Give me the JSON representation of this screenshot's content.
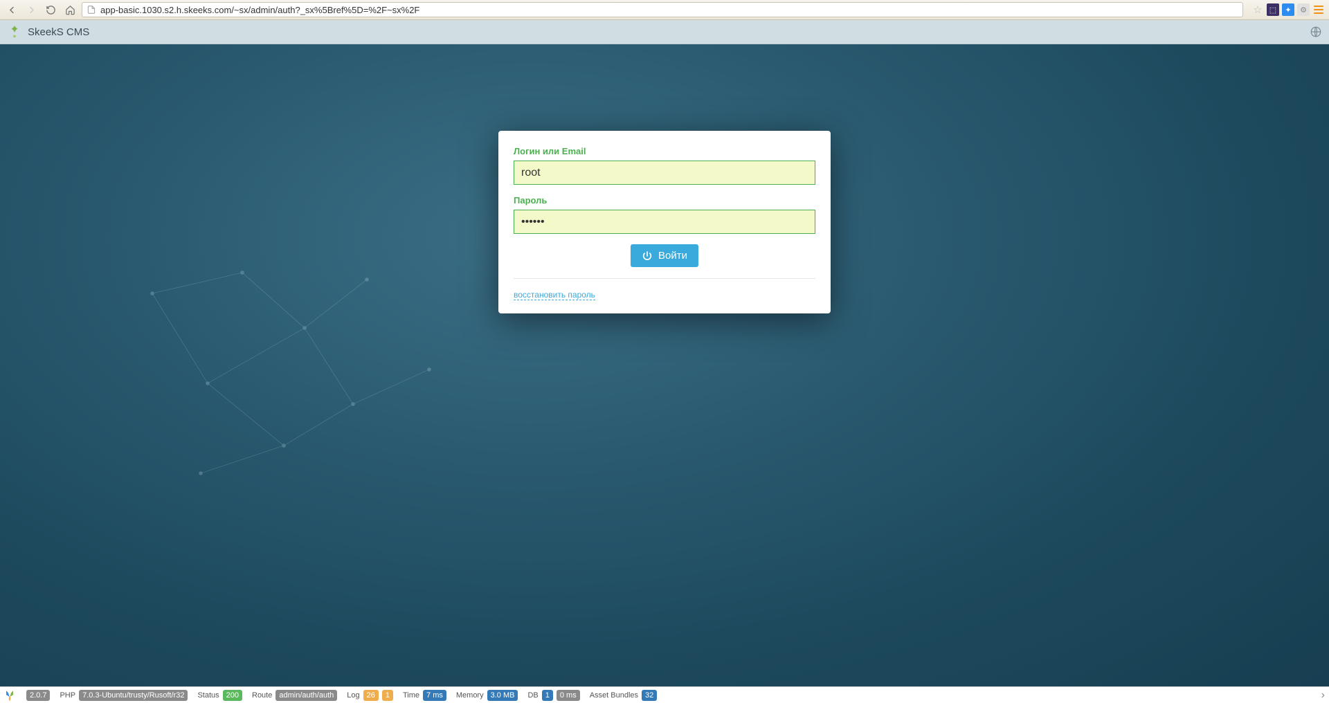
{
  "browser": {
    "url": "app-basic.1030.s2.h.skeeks.com/~sx/admin/auth?_sx%5Bref%5D=%2F~sx%2F"
  },
  "header": {
    "title": "SkeekS CMS"
  },
  "login": {
    "username_label": "Логин или Email",
    "username_value": "root",
    "password_label": "Пароль",
    "password_value": "••••••",
    "submit_label": "Войти",
    "recover_label": "восстановить пароль"
  },
  "debug": {
    "version": "2.0.7",
    "php_label": "PHP",
    "php_version": "7.0.3-Ubuntu/trusty/Rusoft/r32",
    "status_label": "Status",
    "status_value": "200",
    "route_label": "Route",
    "route_value": "admin/auth/auth",
    "log_label": "Log",
    "log_value1": "26",
    "log_value2": "1",
    "time_label": "Time",
    "time_value": "7 ms",
    "memory_label": "Memory",
    "memory_value": "3.0 MB",
    "db_label": "DB",
    "db_value1": "1",
    "db_value2": "0 ms",
    "assets_label": "Asset Bundles",
    "assets_value": "32"
  }
}
